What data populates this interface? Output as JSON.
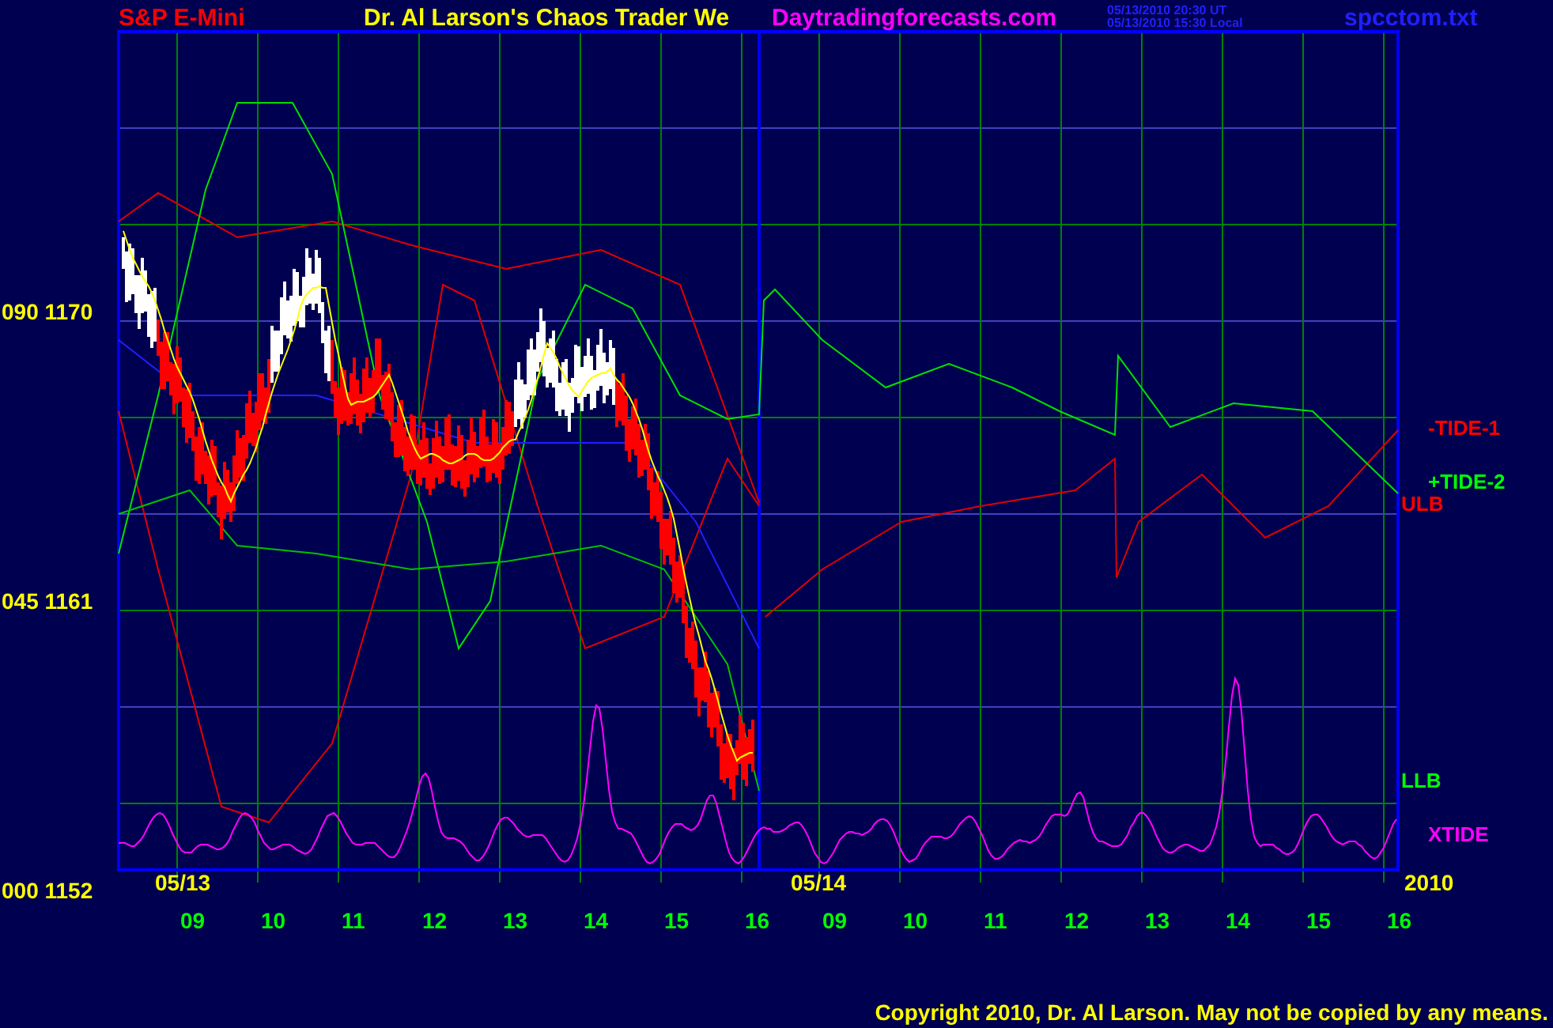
{
  "header": {
    "symbol": "S&P E-Mini",
    "title": "Dr. Al Larson's Chaos Trader We",
    "site": "Daytradingforecasts.com",
    "timestamps": [
      "05/13/2010 20:30 UT",
      "05/13/2010 15:30 Local"
    ],
    "file": "spcctom.txt"
  },
  "chart": {
    "y_labels": [
      "090 1170",
      "045 1161",
      "000 1152"
    ],
    "x_hours": [
      "09",
      "10",
      "11",
      "12",
      "13",
      "14",
      "15",
      "16",
      "09",
      "10",
      "11",
      "12",
      "13",
      "14",
      "15",
      "16"
    ],
    "dates": [
      "05/13",
      "05/14"
    ],
    "year": "2010",
    "series_labels": [
      {
        "text": "-TIDE-1",
        "color": "#ff0000"
      },
      {
        "text": "+TIDE-2",
        "color": "#00ff00"
      },
      {
        "text": "ULB",
        "color": "#ff0000"
      },
      {
        "text": "LLB",
        "color": "#00ff00"
      },
      {
        "text": "XTIDE",
        "color": "#ff00ff"
      }
    ]
  },
  "copyright": "Copyright 2010, Dr. Al Larson. May not be copied by any means."
}
